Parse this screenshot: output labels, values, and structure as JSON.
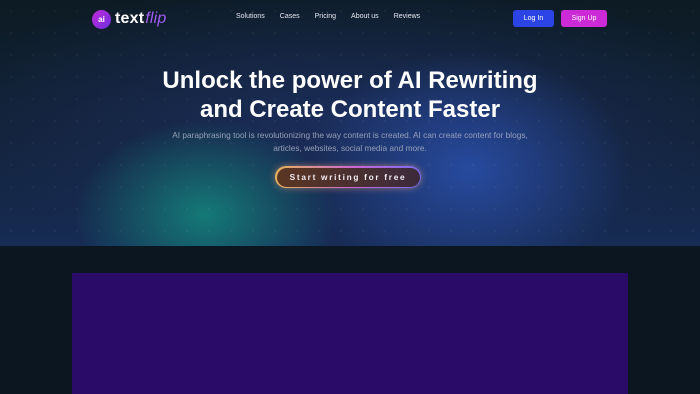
{
  "brand": {
    "badge": "ai",
    "name_main": "text",
    "name_accent": "flip"
  },
  "nav": {
    "links": [
      "Solutions",
      "Cases",
      "Pricing",
      "About us",
      "Reviews"
    ],
    "login_label": "Log In",
    "signup_label": "Sign Up"
  },
  "hero": {
    "title_line1": "Unlock the power of AI Rewriting",
    "title_line2": "and Create Content Faster",
    "subtitle_line1": "AI paraphrasing tool is revolutionizing the way content is created. AI can create content for blogs,",
    "subtitle_line2": "articles, websites, social media and more.",
    "cta_label": "Start writing for free"
  },
  "colors": {
    "login_button": "#2c44e6",
    "signup_button": "#cc2ad6",
    "brand_accent": "#a05cf2",
    "preview_panel": "#2b0b68",
    "page_background": "#0c1620"
  }
}
